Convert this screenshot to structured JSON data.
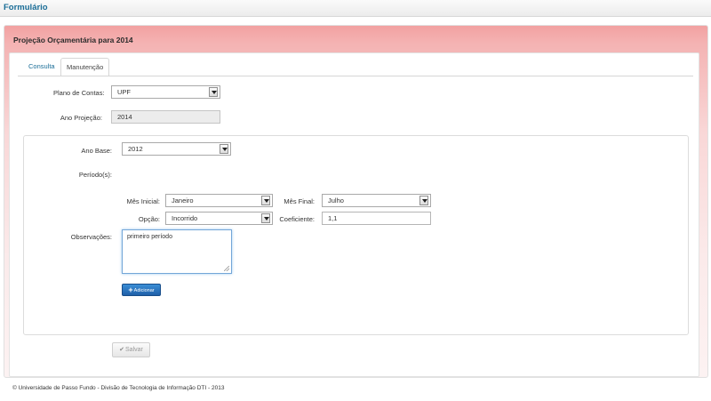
{
  "page": {
    "title": "Formulário"
  },
  "panel": {
    "header": "Projeção Orçamentária para 2014"
  },
  "tabs": [
    {
      "label": "Consulta",
      "active": false
    },
    {
      "label": "Manutenção",
      "active": true
    }
  ],
  "form": {
    "plano_contas": {
      "label": "Plano de Contas:",
      "value": "UPF"
    },
    "ano_projecao": {
      "label": "Ano Projeção:",
      "value": "2014"
    },
    "ano_base": {
      "label": "Ano Base:",
      "value": "2012"
    },
    "periodos": {
      "label": "Período(s):"
    },
    "mes_inicial": {
      "label": "Mês Inicial:",
      "value": "Janeiro"
    },
    "mes_final": {
      "label": "Mês Final:",
      "value": "Julho"
    },
    "opcao": {
      "label": "Opção:",
      "value": "Incorrido"
    },
    "coeficiente": {
      "label": "Coeficiente:",
      "value": "1,1"
    },
    "observacoes": {
      "label": "Observações:",
      "value": "primeiro período"
    }
  },
  "buttons": {
    "add_label": "Adicionar",
    "save_label": "Salvar"
  },
  "footer": {
    "text": "© Universidade de Passo Fundo - Divisão de Tecnologia de Informação DTI - 2013"
  },
  "colors": {
    "header_gradient": "#f2a1a1",
    "link": "#1a6d97",
    "primary_button": "#2a76c3"
  }
}
